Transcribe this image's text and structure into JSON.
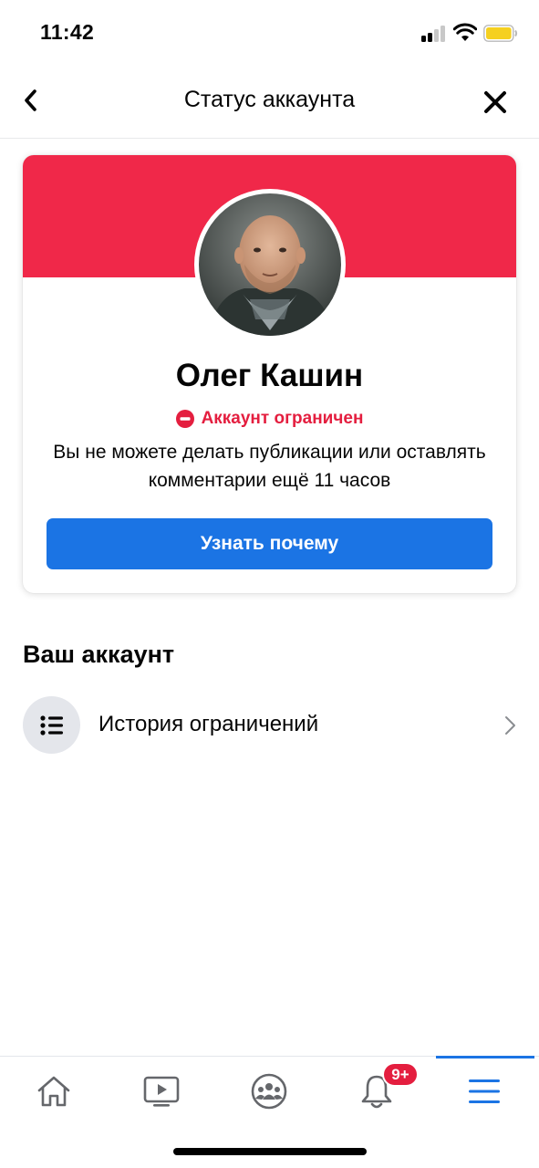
{
  "status_bar": {
    "time": "11:42",
    "icons": [
      "signal-icon",
      "wifi-icon",
      "battery-icon"
    ],
    "battery_color": "#f5d020"
  },
  "header": {
    "title": "Статус аккаунта",
    "back_icon": "chevron-left-icon",
    "close_icon": "close-icon"
  },
  "card": {
    "banner_color": "#f02849",
    "name": "Олег Кашин",
    "status_label": "Аккаунт ограничен",
    "status_icon": "no-entry-icon",
    "status_color": "#e41e3f",
    "description": "Вы не можете делать публикации или оставлять комментарии ещё 11 часов",
    "button_label": "Узнать почему",
    "button_color": "#1b74e4"
  },
  "section": {
    "title": "Ваш аккаунт",
    "items": [
      {
        "label": "История ограничений",
        "icon": "list-icon",
        "chevron": "chevron-right-icon"
      }
    ]
  },
  "tabbar": {
    "tabs": [
      {
        "name": "home",
        "icon": "home-icon",
        "active": false
      },
      {
        "name": "watch",
        "icon": "video-icon",
        "active": false
      },
      {
        "name": "groups",
        "icon": "groups-icon",
        "active": false
      },
      {
        "name": "notifications",
        "icon": "bell-icon",
        "active": false,
        "badge": "9+"
      },
      {
        "name": "menu",
        "icon": "menu-icon",
        "active": true
      }
    ],
    "accent_color": "#1b74e4"
  }
}
